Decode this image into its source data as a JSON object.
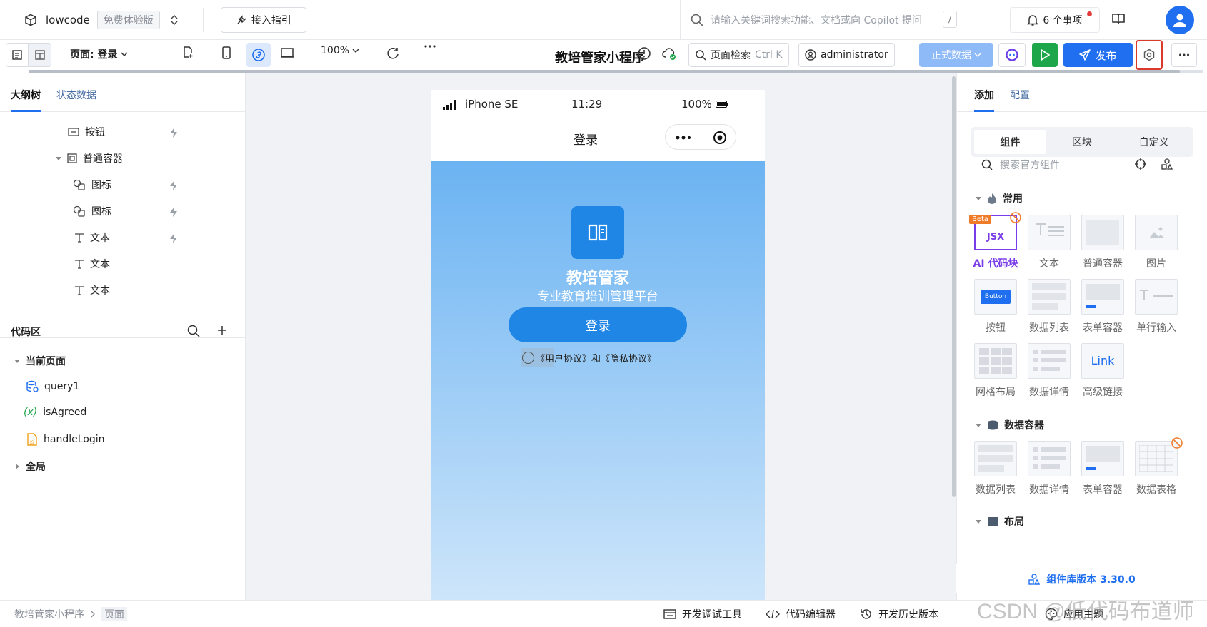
{
  "header": {
    "brand": "lowcode",
    "plan_tag": "免费体验版",
    "guide_label": "接入指引",
    "search_placeholder": "请输入关键词搜索功能、文档或向 Copilot 提问",
    "search_kbd": "/",
    "notifications": "6 个事项"
  },
  "toolbar": {
    "page_label": "页面: 登录",
    "zoom": "100%",
    "app_title": "教培管家小程序",
    "page_search": "页面检索",
    "page_search_kbd": "Ctrl K",
    "user": "administrator",
    "data_env": "正式数据",
    "publish": "发布",
    "progress_fraction": 0.98
  },
  "left": {
    "tabs": [
      {
        "label": "大纲树",
        "active": true
      },
      {
        "label": "状态数据",
        "active": false
      }
    ],
    "tree": [
      {
        "label": "按钮",
        "icon": "button-icon",
        "bolt": true
      },
      {
        "label": "普通容器",
        "icon": "container-icon",
        "bolt": false
      },
      {
        "label": "图标",
        "icon": "icon-component-icon",
        "bolt": true
      },
      {
        "label": "图标",
        "icon": "icon-component-icon",
        "bolt": true
      },
      {
        "label": "文本",
        "icon": "text-icon",
        "bolt": true
      },
      {
        "label": "文本",
        "icon": "text-icon",
        "bolt": false
      },
      {
        "label": "文本",
        "icon": "text-icon",
        "bolt": false
      }
    ],
    "code_title": "代码区",
    "current_page": "当前页面",
    "code_items": [
      {
        "label": "query1",
        "icon": "database-icon"
      },
      {
        "label": "isAgreed",
        "icon": "variable-icon"
      },
      {
        "label": "handleLogin",
        "icon": "js-file-icon"
      }
    ],
    "global": "全局"
  },
  "phone": {
    "device": "iPhone SE",
    "time": "11:29",
    "battery": "100%",
    "nav_title": "登录",
    "app_name": "教培管家",
    "subtitle": "专业教育培训管理平台",
    "login_btn": "登录",
    "agreement": "《用户协议》和《隐私协议》"
  },
  "right": {
    "tabs": [
      {
        "label": "添加",
        "active": true
      },
      {
        "label": "配置",
        "active": false
      }
    ],
    "segments": [
      "组件",
      "区块",
      "自定义"
    ],
    "search_placeholder": "搜索官方组件",
    "sections": [
      {
        "title": "常用",
        "items": [
          "AI 代码块",
          "文本",
          "普通容器",
          "图片",
          "按钮",
          "数据列表",
          "表单容器",
          "单行输入",
          "网格布局",
          "数据详情",
          "高级链接"
        ]
      },
      {
        "title": "数据容器",
        "items": [
          "数据列表",
          "数据详情",
          "表单容器",
          "数据表格"
        ]
      },
      {
        "title": "布局",
        "items": []
      }
    ],
    "beta": "Beta",
    "jsx": "JSX",
    "button_thumb": "Button",
    "link_thumb": "Link",
    "version": "组件库版本 3.30.0"
  },
  "bottom": {
    "crumbs": [
      "教培管家小程序",
      "页面"
    ],
    "tools": [
      "开发调试工具",
      "代码编辑器",
      "开发历史版本",
      "应用主题"
    ],
    "watermark": "CSDN @低代码布道师"
  },
  "colors": {
    "primary": "#1f6ff0",
    "success": "#1ea64a",
    "highlight": "#d93a2b"
  }
}
